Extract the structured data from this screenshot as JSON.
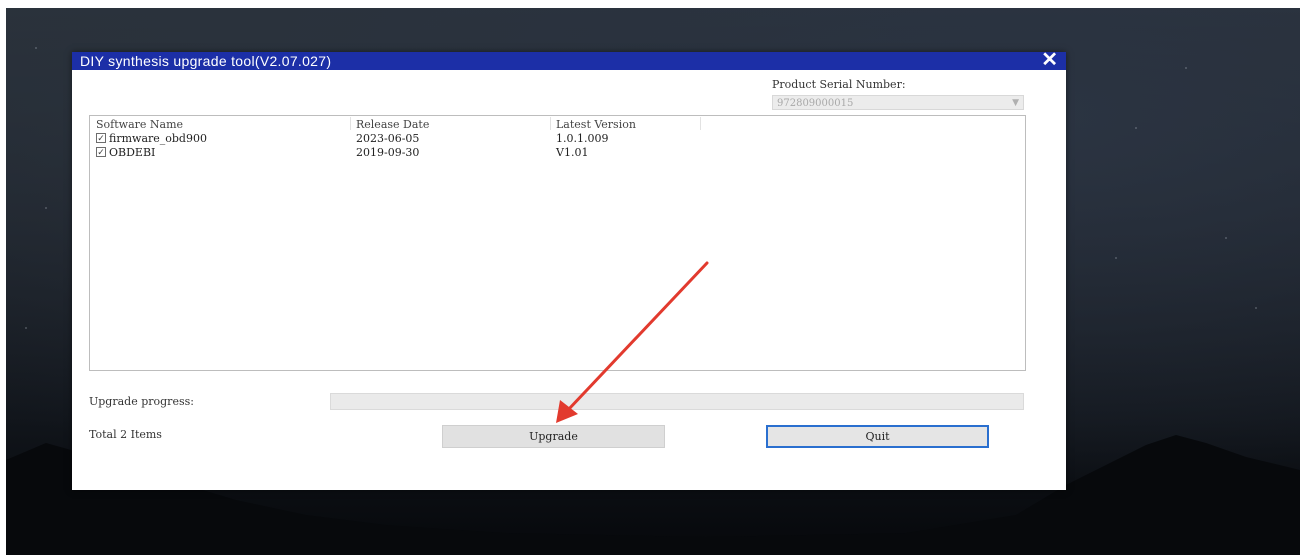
{
  "window": {
    "title": "DIY synthesis upgrade tool(V2.07.027)",
    "close_glyph": "✕"
  },
  "serial": {
    "label": "Product Serial Number:",
    "value": "972809000015",
    "chevron_icon": "chevron-down-icon"
  },
  "list": {
    "headers": [
      "Software Name",
      "Release Date",
      "Latest Version"
    ],
    "rows": [
      {
        "checked": true,
        "name": "firmware_obd900",
        "date": "2023-06-05",
        "version": "1.0.1.009"
      },
      {
        "checked": true,
        "name": "OBDEBI",
        "date": "2019-09-30",
        "version": "V1.01"
      }
    ]
  },
  "progress": {
    "label": "Upgrade progress:",
    "value_fraction": 0
  },
  "footer": {
    "total": "Total 2 Items",
    "upgrade_label": "Upgrade",
    "quit_label": "Quit"
  },
  "colors": {
    "titlebar": "#1c2fa7",
    "annotation_arrow": "#e23a2e",
    "focus_border": "#2a6fcf"
  }
}
